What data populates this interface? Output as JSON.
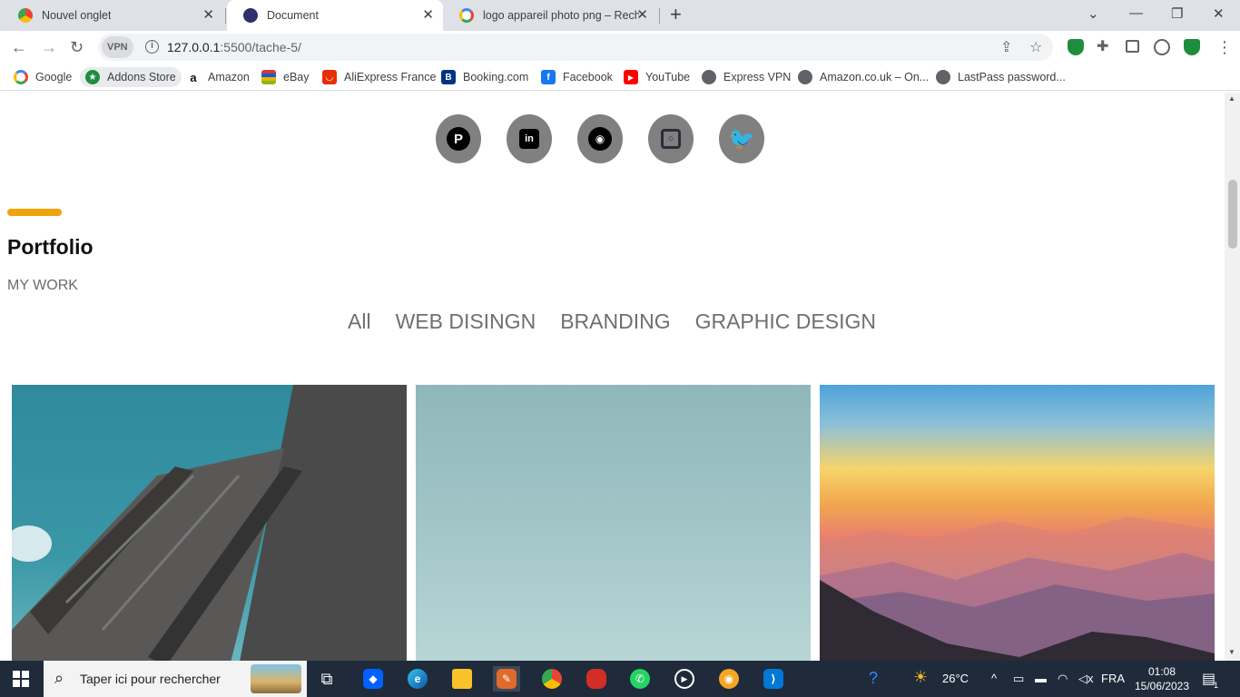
{
  "tabs": [
    {
      "title": "Nouvel onglet",
      "favicon": "chrome-icon"
    },
    {
      "title": "Document",
      "favicon": "globe-icon",
      "active": true
    },
    {
      "title": "logo appareil photo png – Reche",
      "favicon": "google-icon"
    }
  ],
  "toolbar": {
    "vpn_label": "VPN",
    "url_host": "127.0.0.1",
    "url_path": ":5500/tache-5/"
  },
  "bookmarks": [
    {
      "label": "Google",
      "icon": "google-icon"
    },
    {
      "label": "Addons Store",
      "icon": "addons-icon"
    },
    {
      "label": "Amazon",
      "icon": "amazon-icon"
    },
    {
      "label": "eBay",
      "icon": "ebay-icon"
    },
    {
      "label": "AliExpress France",
      "icon": "aliexpress-icon"
    },
    {
      "label": "Booking.com",
      "icon": "booking-icon"
    },
    {
      "label": "Facebook",
      "icon": "facebook-icon"
    },
    {
      "label": "YouTube",
      "icon": "youtube-icon"
    },
    {
      "label": "Express VPN",
      "icon": "globe-icon"
    },
    {
      "label": "Amazon.co.uk – On...",
      "icon": "globe-icon"
    },
    {
      "label": "LastPass password...",
      "icon": "globe-icon"
    }
  ],
  "social": [
    "pinterest-icon",
    "linkedin-icon",
    "camera-icon",
    "instagram-icon",
    "twitter-icon"
  ],
  "portfolio": {
    "title": "Portfolio",
    "subtitle": "MY WORK",
    "filters": [
      "All",
      "WEB DISINGN",
      "BRANDING",
      "GRAPHIC DESIGN"
    ],
    "accent_color": "#f0a30a"
  },
  "taskbar": {
    "search_placeholder": "Taper ici pour rechercher",
    "weather": "26°C",
    "language": "FRA",
    "time": "01:08",
    "date": "15/06/2023",
    "notification_count": "1"
  }
}
